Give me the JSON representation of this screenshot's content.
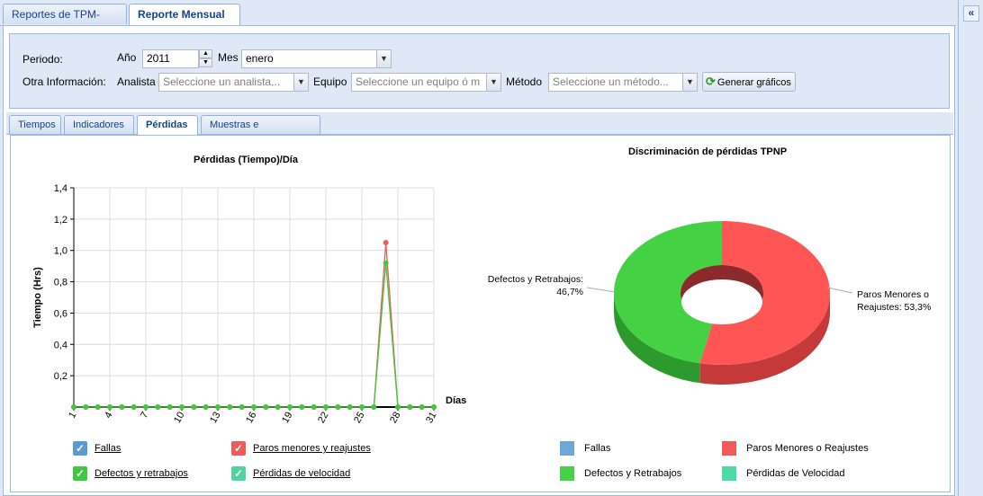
{
  "top_tabs": [
    {
      "label": "Reportes de TPM-QLabs"
    },
    {
      "label": "Reporte Mensual",
      "close": "×"
    }
  ],
  "side_collapse": "«",
  "form": {
    "periodo_label": "Periodo:",
    "anio_label": "Año",
    "anio_value": "2011",
    "mes_label": "Mes",
    "mes_value": "enero",
    "otra_label": "Otra Información:",
    "analista_label": "Analista",
    "analista_placeholder": "Seleccione un analista...",
    "equipo_label": "Equipo",
    "equipo_placeholder": "Seleccione un equipo ó m",
    "metodo_label": "Método",
    "metodo_placeholder": "Seleccione un método...",
    "generate_button": "Generar gráficos"
  },
  "sub_tabs": [
    "Tiempos",
    "Indicadores",
    "Pérdidas",
    "Muestras e inyecciones"
  ],
  "active_sub_tab": "Pérdidas",
  "line_legend": [
    {
      "label": "Fallas",
      "color": "#5b9bd5"
    },
    {
      "label": "Paros menores y reajustes",
      "color": "#f25a5a"
    },
    {
      "label": "Defectos y retrabajos",
      "color": "#3ec93e"
    },
    {
      "label": "Pérdidas de velocidad",
      "color": "#4fd3a0"
    }
  ],
  "pie_legend": [
    {
      "label": "Fallas",
      "color": "#6fa7d4"
    },
    {
      "label": "Paros Menores o Reajustes",
      "color": "#f25a5a"
    },
    {
      "label": "Defectos y Retrabajos",
      "color": "#48d048"
    },
    {
      "label": "Pérdidas de Velocidad",
      "color": "#4fd8a8"
    }
  ],
  "chart_data": [
    {
      "type": "line",
      "title": "Pérdidas (Tiempo)/Día",
      "xlabel": "Días",
      "ylabel": "Tiempo (Hrs)",
      "xlim": [
        1,
        31
      ],
      "ylim": [
        0,
        1.4
      ],
      "x_ticks": [
        "1",
        "4",
        "7",
        "10",
        "13",
        "16",
        "19",
        "22",
        "25",
        "28",
        "31"
      ],
      "y_ticks": [
        "0,2",
        "0,4",
        "0,6",
        "0,8",
        "1,0",
        "1,2",
        "1,4"
      ],
      "grid": true,
      "series": [
        {
          "name": "Paros menores y reajustes",
          "color": "#f25a5a",
          "values": [
            0,
            0,
            0,
            0,
            0,
            0,
            0,
            0,
            0,
            0,
            0,
            0,
            0,
            0,
            0,
            0,
            0,
            0,
            0,
            0,
            0,
            0,
            0,
            0,
            0,
            0,
            1.05,
            0,
            0,
            0,
            0
          ]
        },
        {
          "name": "Defectos y retrabajos",
          "color": "#3ec93e",
          "values": [
            0,
            0,
            0,
            0,
            0,
            0,
            0,
            0,
            0,
            0,
            0,
            0,
            0,
            0,
            0,
            0,
            0,
            0,
            0,
            0,
            0,
            0,
            0,
            0,
            0,
            0,
            0.92,
            0,
            0,
            0,
            0
          ]
        }
      ]
    },
    {
      "type": "pie",
      "title": "Discriminación de pérdidas TPNP",
      "slices": [
        {
          "name": "Paros Menores o Reajustes",
          "value": 53.3,
          "label_lines": [
            "Paros Menores o",
            "Reajustes: 53,3%"
          ]
        },
        {
          "name": "Defectos y Retrabajos",
          "value": 46.7,
          "label_lines": [
            "Defectos y Retrabajos:",
            "46,7%"
          ]
        }
      ]
    }
  ]
}
